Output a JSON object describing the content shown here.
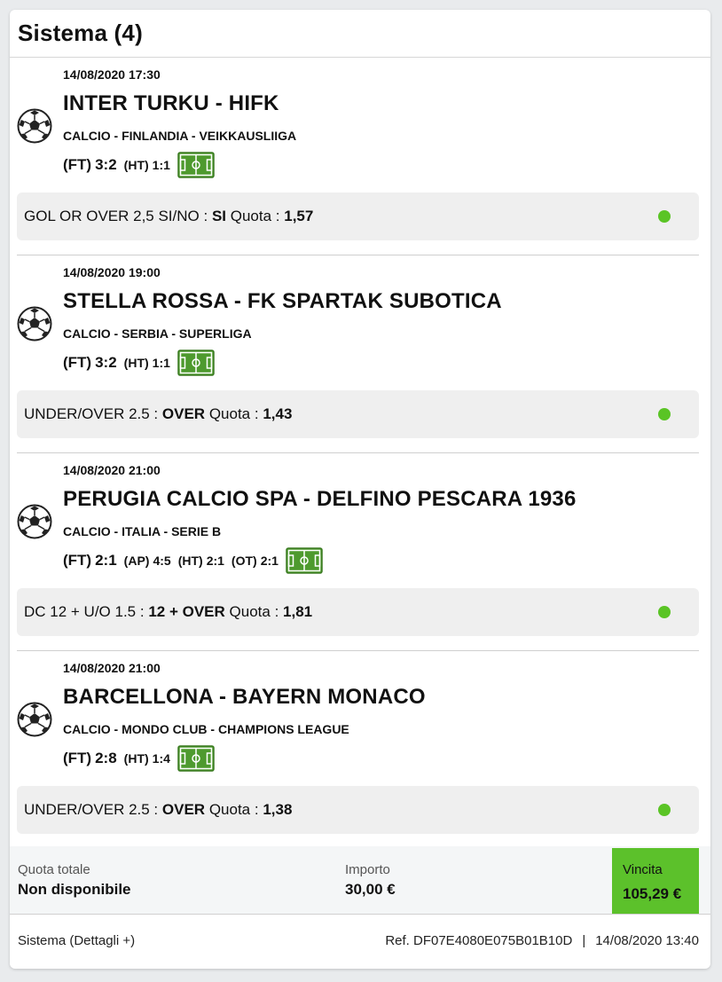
{
  "header": {
    "title": "Sistema (4)"
  },
  "events": [
    {
      "date": "14/08/2020 17:30",
      "match": "INTER TURKU - HIFK",
      "league": "CALCIO - FINLANDIA - VEIKKAUSLIIGA",
      "score": [
        {
          "label": "(FT)",
          "value": "3:2",
          "big": true
        },
        {
          "label": "(HT)",
          "value": "1:1",
          "big": false
        }
      ],
      "bet": {
        "market": "GOL OR OVER 2,5 SI/NO :",
        "pick": "SI",
        "quota_label": "Quota :",
        "quota": "1,57"
      }
    },
    {
      "date": "14/08/2020 19:00",
      "match": "STELLA ROSSA - FK SPARTAK SUBOTICA",
      "league": "CALCIO - SERBIA - SUPERLIGA",
      "score": [
        {
          "label": "(FT)",
          "value": "3:2",
          "big": true
        },
        {
          "label": "(HT)",
          "value": "1:1",
          "big": false
        }
      ],
      "bet": {
        "market": "UNDER/OVER 2.5 :",
        "pick": "OVER",
        "quota_label": "Quota :",
        "quota": "1,43"
      }
    },
    {
      "date": "14/08/2020 21:00",
      "match": "PERUGIA CALCIO SPA - DELFINO PESCARA 1936",
      "league": "CALCIO - ITALIA - SERIE B",
      "score": [
        {
          "label": "(FT)",
          "value": "2:1",
          "big": true
        },
        {
          "label": "(AP)",
          "value": "4:5",
          "big": false
        },
        {
          "label": "(HT)",
          "value": "2:1",
          "big": false
        },
        {
          "label": "(OT)",
          "value": "2:1",
          "big": false
        }
      ],
      "bet": {
        "market": "DC 12 + U/O 1.5 :",
        "pick": "12 + OVER",
        "quota_label": "Quota :",
        "quota": "1,81"
      }
    },
    {
      "date": "14/08/2020 21:00",
      "match": "BARCELLONA - BAYERN MONACO",
      "league": "CALCIO - MONDO CLUB - CHAMPIONS LEAGUE",
      "score": [
        {
          "label": "(FT)",
          "value": "2:8",
          "big": true
        },
        {
          "label": "(HT)",
          "value": "1:4",
          "big": false
        }
      ],
      "bet": {
        "market": "UNDER/OVER 2.5 :",
        "pick": "OVER",
        "quota_label": "Quota :",
        "quota": "1,38"
      }
    }
  ],
  "summary": {
    "quota_totale_label": "Quota totale",
    "quota_totale_value": "Non disponibile",
    "importo_label": "Importo",
    "importo_value": "30,00 €",
    "vincita_label": "Vincita",
    "vincita_value": "105,29 €"
  },
  "footer": {
    "details_link": "Sistema (Dettagli +)",
    "ref": "Ref. DF07E4080E075B01B10D",
    "separator": "|",
    "timestamp": "14/08/2020 13:40"
  },
  "colors": {
    "won_dot": "#5ac425",
    "vincita_bg": "#5cc12b",
    "field_icon": "#4e9a2e"
  },
  "icons": {
    "sport": "soccer-ball-icon",
    "field": "soccer-field-icon",
    "status": "won-status-dot"
  }
}
